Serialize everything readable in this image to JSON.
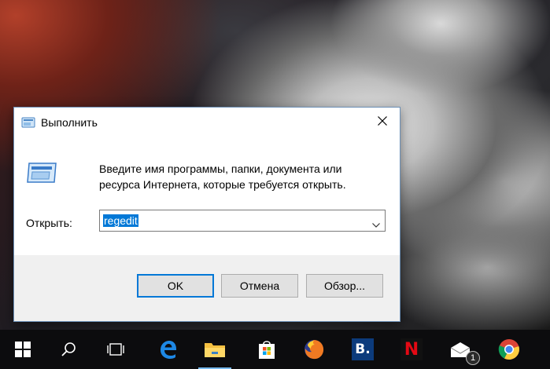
{
  "dialog": {
    "title": "Выполнить",
    "description_line1": "Введите имя программы, папки, документа или",
    "description_line2": "ресурса Интернета, которые требуется открыть.",
    "open_label": "Открыть:",
    "open_value": "regedit",
    "buttons": {
      "ok": "OK",
      "cancel": "Отмена",
      "browse": "Обзор..."
    }
  },
  "taskbar": {
    "items": [
      {
        "name": "start-button",
        "icon": "windows-logo-icon"
      },
      {
        "name": "search-button",
        "icon": "search-icon"
      },
      {
        "name": "task-view-button",
        "icon": "task-view-icon"
      },
      {
        "name": "edge-button",
        "icon": "edge-icon"
      },
      {
        "name": "file-explorer-button",
        "icon": "folder-icon"
      },
      {
        "name": "store-button",
        "icon": "store-icon"
      },
      {
        "name": "firefox-button",
        "icon": "firefox-icon"
      },
      {
        "name": "booking-button",
        "icon": "booking-icon",
        "text": "B."
      },
      {
        "name": "netflix-button",
        "icon": "netflix-icon",
        "text": "N"
      },
      {
        "name": "mail-button",
        "icon": "mail-icon",
        "badge": "1"
      },
      {
        "name": "chrome-button",
        "icon": "chrome-icon"
      }
    ],
    "mail_badge": "1",
    "booking_text": "B.",
    "netflix_text": "N"
  },
  "colors": {
    "accent": "#0078d7",
    "taskbar": "#0c0c0e",
    "dialog_footer": "#f0f0f0"
  }
}
